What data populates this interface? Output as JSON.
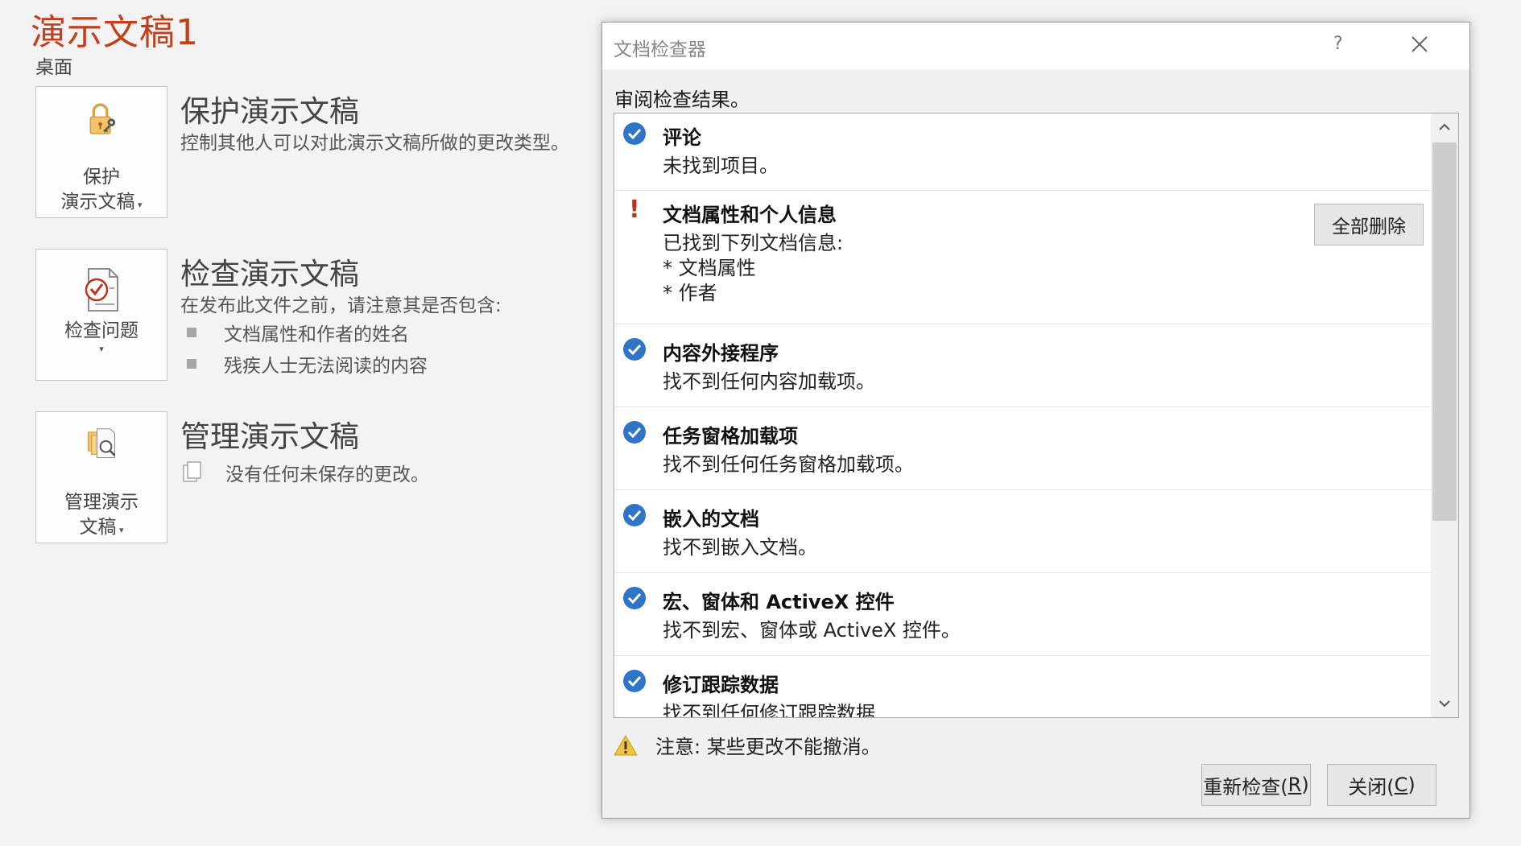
{
  "backstage": {
    "title": "演示文稿1",
    "location": "桌面",
    "protect": {
      "tile_label": "保护\n演示文稿",
      "heading": "保护演示文稿",
      "description": "控制其他人可以对此演示文稿所做的更改类型。",
      "icon": "lock-key-icon"
    },
    "inspect": {
      "tile_label": "检查问题",
      "heading": "检查演示文稿",
      "description": "在发布此文件之前，请注意其是否包含:",
      "bullets": [
        "文档属性和作者的姓名",
        "残疾人士无法阅读的内容"
      ],
      "icon": "checklist-icon"
    },
    "manage": {
      "tile_label": "管理演示\n文稿",
      "heading": "管理演示文稿",
      "description": "没有任何未保存的更改。",
      "icon": "manage-docs-icon"
    }
  },
  "dialog": {
    "title": "文档检查器",
    "help": "?",
    "review_label": "审阅检查结果。",
    "results": [
      {
        "status": "ok",
        "title": "评论",
        "body": "未找到项目。"
      },
      {
        "status": "warning",
        "title": "文档属性和个人信息",
        "body": "已找到下列文档信息:\n* 文档属性\n* 作者",
        "action": "全部删除"
      },
      {
        "status": "ok",
        "title": "内容外接程序",
        "body": "找不到任何内容加载项。"
      },
      {
        "status": "ok",
        "title": "任务窗格加载项",
        "body": "找不到任何任务窗格加载项。"
      },
      {
        "status": "ok",
        "title": "嵌入的文档",
        "body": "找不到嵌入文档。"
      },
      {
        "status": "ok",
        "title": "宏、窗体和 ActiveX 控件",
        "body": "找不到宏、窗体或 ActiveX 控件。"
      },
      {
        "status": "ok",
        "title": "修订跟踪数据",
        "body": "找不到任何修订跟踪数据"
      }
    ],
    "note": "注意: 某些更改不能撤消。",
    "reinspect_label": "重新检查(",
    "reinspect_key": "R",
    "close_label": "关闭(",
    "close_key": "C",
    "label_suffix": ")",
    "colors": {
      "ok": "#2e75c8",
      "warning": "#c4311c",
      "accent": "#c43e1c"
    }
  }
}
